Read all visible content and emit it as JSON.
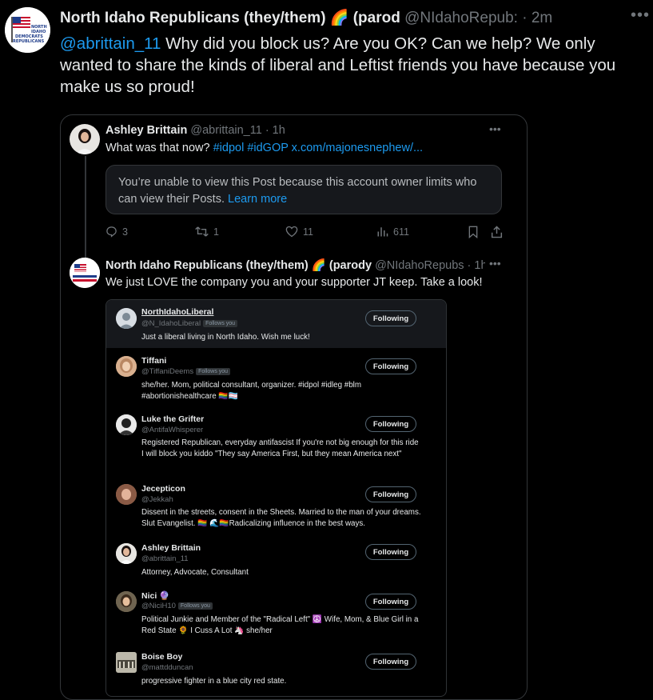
{
  "main_post": {
    "author_name": "North Idaho Republicans (they/them) 🌈 (parod",
    "author_handle": "@NIdahoRepub: · 2m",
    "more_label": "•••",
    "mention": "@abrittain_11",
    "text": " Why did you block us?  Are you OK?  Can we help? We only wanted to share the kinds of liberal and Leftist friends you have because you make us so proud!",
    "avatar_text": [
      "NORTH",
      "IDAHO",
      "DEMOCRATS",
      "REPUBLICANS"
    ]
  },
  "quote": {
    "first": {
      "name": "Ashley Brittain",
      "handle": "@abrittain_11 · 1h",
      "text_plain": "What was that now? ",
      "text_links": "#idpol #idGOP x.com/majonesnephew/...",
      "more_label": "•••",
      "restricted_text": "You’re unable to view this Post because this account owner limits who can view their Posts. ",
      "learn_more": "Learn more",
      "replies": "3",
      "reposts": "1",
      "likes": "11",
      "views": "611"
    },
    "second": {
      "name": "North Idaho Republicans (they/them) 🌈 (parody",
      "handle": "@NIdahoRepubs · 1h",
      "more_label": "•••",
      "text": "We just LOVE the company you and your supporter JT keep.  Take a look!"
    }
  },
  "screenshot": {
    "follows_you": "Follows you",
    "following_label": "Following",
    "items": [
      {
        "name": "NorthIdahoLiberal",
        "handle": "@N_IdahoLiberal",
        "follows_you": true,
        "bio": "Just a liberal living in North Idaho. Wish me luck!"
      },
      {
        "name": "Tiffani",
        "handle": "@TiffaniDeems",
        "follows_you": true,
        "bio": "she/her. Mom, political consultant, organizer. #idpol #idleg #blm #abortionishealthcare 🏳️‍🌈🏳️‍⚧️"
      },
      {
        "name": "Luke the Grifter",
        "handle": "@AntifaWhisperer",
        "follows_you": false,
        "bio": "Registered Republican, everyday antifascist If you're not big enough for this ride I will block you kiddo \"They say America First, but they mean America next\""
      },
      {
        "name": "Jecepticon",
        "handle": "@Jekkah",
        "follows_you": false,
        "bio": "Dissent in the streets, consent in the Sheets. Married to the man of your dreams. Slut Evangelist. 🏳️‍🌈 🌊🏳️‍🌈Radicalizing influence in the best ways."
      },
      {
        "name": "Ashley Brittain",
        "handle": "@abrittain_11",
        "follows_you": false,
        "bio": "Attorney, Advocate, Consultant"
      },
      {
        "name": "Nici 🔮",
        "handle": "@NiciH10",
        "follows_you": true,
        "bio": "Political Junkie and Member of the \"Radical Left\" ☮️ Wife, Mom, & Blue Girl in a Red State 🌻 I Cuss A Lot 🦄 she/her"
      },
      {
        "name": "Boise Boy",
        "handle": "@mattdduncan",
        "follows_you": false,
        "bio": "progressive fighter in a blue city red state."
      }
    ]
  },
  "colors": {
    "link": "#1d9bf0",
    "muted": "#71767b",
    "text": "#e7e9ea",
    "border": "#333639"
  }
}
